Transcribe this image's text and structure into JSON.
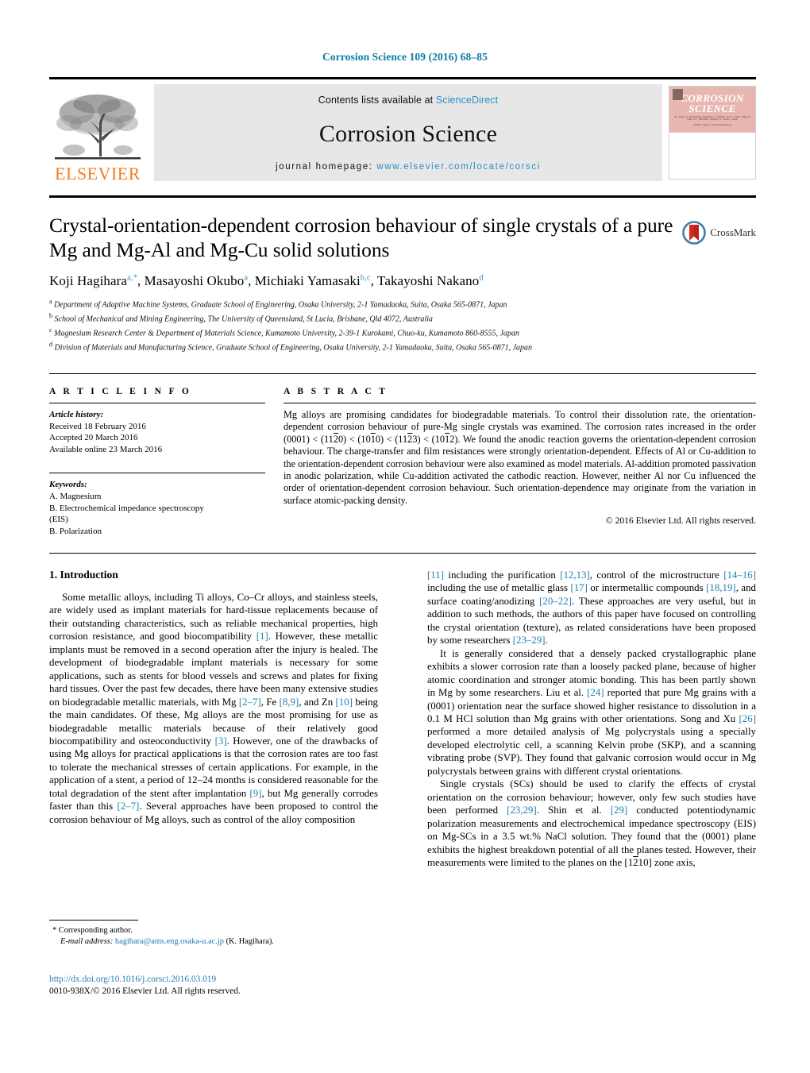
{
  "running_head": "Corrosion Science 109 (2016) 68–85",
  "masthead": {
    "publisher_logo_text": "ELSEVIER",
    "contents_prefix": "Contents lists available at ",
    "contents_link": "ScienceDirect",
    "journal_name": "Corrosion Science",
    "homepage_prefix": "journal homepage: ",
    "homepage_url": "www.elsevier.com/locate/corsci",
    "cover": {
      "line1": "CORROSION",
      "line2": "SCIENCE",
      "blurb": "The Journal on Environmental Degradation of Materials and its Control Editors-in-Chief: R.C. NEWMAN, University of Toronto, Canada",
      "blurb2": "Available online at www.sciencedirect.com"
    }
  },
  "article": {
    "title": "Crystal-orientation-dependent corrosion behaviour of single crystals of a pure Mg and Mg-Al and Mg-Cu solid solutions",
    "crossmark_label": "CrossMark",
    "authors": [
      {
        "name": "Koji Hagihara",
        "sup": "a,*"
      },
      {
        "name": "Masayoshi Okubo",
        "sup": "a"
      },
      {
        "name": "Michiaki Yamasaki",
        "sup": "b,c"
      },
      {
        "name": "Takayoshi Nakano",
        "sup": "d"
      }
    ],
    "affiliations": [
      {
        "marker": "a",
        "text": "Department of Adaptive Machine Systems, Graduate School of Engineering, Osaka University, 2-1 Yamadaoka, Suita, Osaka 565-0871, Japan"
      },
      {
        "marker": "b",
        "text": "School of Mechanical and Mining Engineering, The University of Queensland, St Lucia, Brisbane, Qld 4072, Australia"
      },
      {
        "marker": "c",
        "text": "Magnesium Research Center & Department of Materials Science, Kumamoto University, 2-39-1 Kurokami, Chuo-ku, Kumamoto 860-8555, Japan"
      },
      {
        "marker": "d",
        "text": "Division of Materials and Manufacturing Science, Graduate School of Engineering, Osaka University, 2-1 Yamadaoka, Suita, Osaka 565-0871, Japan"
      }
    ]
  },
  "article_info": {
    "heading": "A R T I C L E   I N F O",
    "history_title": "Article history:",
    "history": [
      "Received 18 February 2016",
      "Accepted 20 March 2016",
      "Available online 23 March 2016"
    ],
    "keywords_title": "Keywords:",
    "keywords": [
      "A. Magnesium",
      "B. Electrochemical impedance spectroscopy",
      "(EIS)",
      "B. Polarization"
    ]
  },
  "abstract": {
    "heading": "A B S T R A C T",
    "part1": "Mg alloys are promising candidates for biodegradable materials. To control their dissolution rate, the orientation-dependent corrosion behaviour of pure-Mg single crystals was examined. The corrosion rates increased in the order (0001) < (11",
    "idx1_bar": "2",
    "part2": "0) < (10",
    "idx2_bar": "1",
    "part3": "0) < (11",
    "idx3_bar": "2",
    "part4": "3) < (10",
    "idx4_bar": "1",
    "part5": "2). We found the anodic reaction governs the orientation-dependent corrosion behaviour. The charge-transfer and film resistances were strongly orientation-dependent. Effects of Al or Cu-addition to the orientation-dependent corrosion behaviour were also examined as model materials. Al-addition promoted passivation in anodic polarization, while Cu-addition activated the cathodic reaction. However, neither Al nor Cu influenced the order of orientation-dependent corrosion behaviour. Such orientation-dependence may originate from the variation in surface atomic-packing density.",
    "copyright": "© 2016 Elsevier Ltd. All rights reserved."
  },
  "body": {
    "section_title": "1.  Introduction",
    "left": {
      "p1_a": "Some metallic alloys, including Ti alloys, Co–Cr alloys, and stainless steels, are widely used as implant materials for hard-tissue replacements because of their outstanding characteristics, such as reliable mechanical properties, high corrosion resistance, and good biocompatibility ",
      "c1": "[1]",
      "p1_b": ". However, these metallic implants must be removed in a second operation after the injury is healed. The development of biodegradable implant materials is necessary for some applications, such as stents for blood vessels and screws and plates for fixing hard tissues. Over the past few decades, there have been many extensive studies on biodegradable metallic materials, with Mg ",
      "c2": "[2–7]",
      "p1_c": ", Fe ",
      "c3": "[8,9]",
      "p1_d": ", and Zn ",
      "c4": "[10]",
      "p1_e": " being the main candidates. Of these, Mg alloys are the most promising for use as biodegradable metallic materials because of their relatively good biocompatibility and osteoconductivity ",
      "c5": "[3]",
      "p1_f": ". However, one of the drawbacks of using Mg alloys for practical applications is that the corrosion rates are too fast to tolerate the mechanical stresses of certain applications. For example, in the application of a stent, a period of 12–24 months is considered reasonable for the total degradation of the stent after implantation ",
      "c6": "[9]",
      "p1_g": ", but Mg generally corrodes faster than this ",
      "c7": "[2–7]",
      "p1_h": ". Several approaches have been proposed to control the corrosion behaviour of Mg alloys, such as control of the alloy composition"
    },
    "right": {
      "c8": "[11]",
      "p2_a": " including the purification ",
      "c9": "[12,13]",
      "p2_b": ", control of the microstructure ",
      "c10": "[14–16]",
      "p2_c": " including the use of metallic glass ",
      "c11": "[17]",
      "p2_d": " or intermetallic compounds ",
      "c12": "[18,19]",
      "p2_e": ", and surface coating/anodizing ",
      "c13": "[20–22]",
      "p2_f": ". These approaches are very useful, but in addition to such methods, the authors of this paper have focused on controlling the crystal orientation (texture), as related considerations have been proposed by some researchers ",
      "c14": "[23–29]",
      "p2_g": ".",
      "p3_a": "It is generally considered that a densely packed crystallographic plane exhibits a slower corrosion rate than a loosely packed plane, because of higher atomic coordination and stronger atomic bonding. This has been partly shown in Mg by some researchers. Liu et al. ",
      "c15": "[24]",
      "p3_b": " reported that pure Mg grains with a (0001) orientation near the surface showed higher resistance to dissolution in a 0.1 M HCl solution than Mg grains with other orientations. Song and Xu ",
      "c16": "[26]",
      "p3_c": " performed a more detailed analysis of Mg polycrystals using a specially developed electrolytic cell, a scanning Kelvin probe (SKP), and a scanning vibrating probe (SVP). They found that galvanic corrosion would occur in Mg polycrystals between grains with different crystal orientations.",
      "p4_a": "Single crystals (SCs) should be used to clarify the effects of crystal orientation on the corrosion behaviour; however, only few such studies have been performed ",
      "c17": "[23,29]",
      "p4_b": ". Shin et al. ",
      "c18": "[29]",
      "p4_c": " conducted potentiodynamic polarization measurements and electrochemical impedance spectroscopy (EIS) on Mg-SCs in a 3.5 wt.% NaCl solution. They found that the (0001) plane exhibits the highest breakdown potential of all the planes tested. However, their measurements were limited to the planes on the [1",
      "p4_bar": "2",
      "p4_d": "10] zone axis,"
    }
  },
  "footnote": {
    "corresponding": "* Corresponding author.",
    "email_label": "E-mail address:",
    "email": "hagihara@ams.eng.osaka-u.ac.jp",
    "email_suffix": " (K. Hagihara)."
  },
  "doi": {
    "link": "http://dx.doi.org/10.1016/j.corsci.2016.03.019",
    "issn": "0010-938X/© 2016 Elsevier Ltd. All rights reserved."
  },
  "colors": {
    "link_blue": "#1f7fb0",
    "header_blue": "#0b7ca8",
    "elsevier_orange": "#f47d20",
    "cover_pink": "#e8b6b0",
    "banner_gray": "#e7e7e7"
  }
}
